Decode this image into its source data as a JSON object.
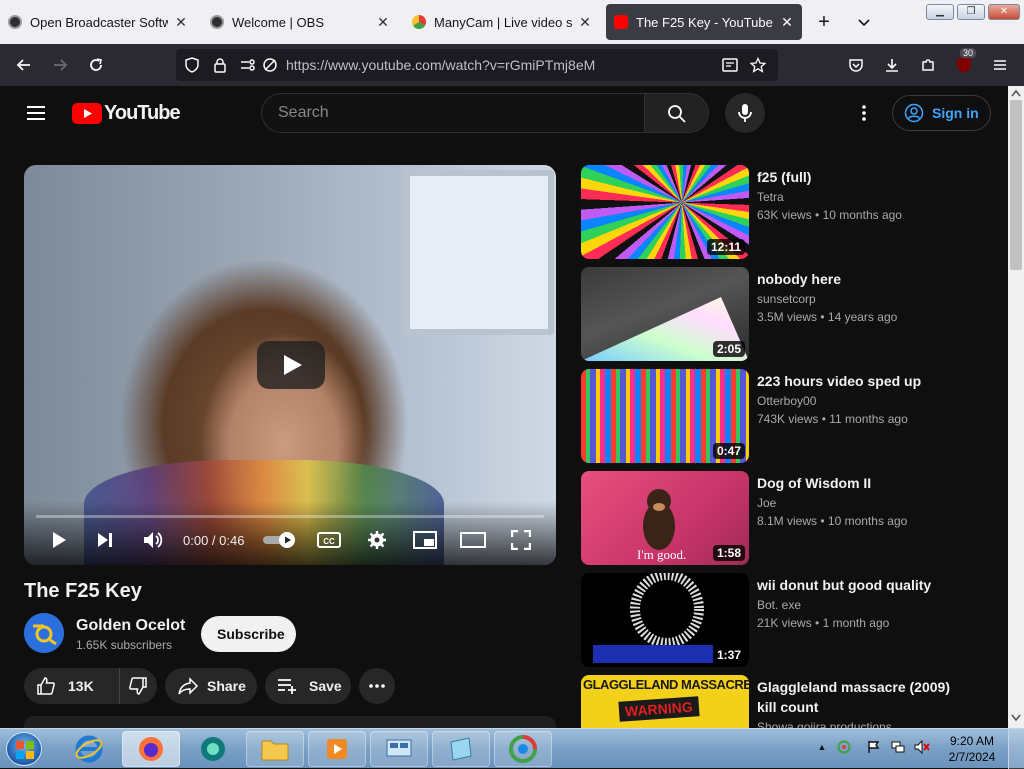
{
  "browser": {
    "tabs": [
      {
        "title": "Open Broadcaster Software",
        "active": false,
        "icon": "obs-icon"
      },
      {
        "title": "Welcome | OBS",
        "active": false,
        "icon": "obs-icon"
      },
      {
        "title": "ManyCam | Live video soft",
        "active": false,
        "icon": "manycam-icon"
      },
      {
        "title": "The F25 Key - YouTube",
        "active": true,
        "icon": "youtube-icon"
      }
    ],
    "url": "https://www.youtube.com/watch?v=rGmiPTmj8eM",
    "extension_badge": "30"
  },
  "youtube": {
    "logo_text": "YouTube",
    "search_placeholder": "Search",
    "sign_in": "Sign in"
  },
  "video": {
    "title": "The F25 Key",
    "time": "0:00 / 0:46",
    "progress": 0,
    "channel": {
      "name": "Golden Ocelot",
      "subscribers": "1.65K subscribers"
    },
    "subscribe_label": "Subscribe",
    "like_count": "13K",
    "share_label": "Share",
    "save_label": "Save"
  },
  "recommendations": [
    {
      "title": "f25 (full)",
      "channel": "Tetra",
      "views": "63K views",
      "age": "10 months ago",
      "duration": "12:11"
    },
    {
      "title": "nobody here",
      "channel": "sunsetcorp",
      "views": "3.5M views",
      "age": "14 years ago",
      "duration": "2:05"
    },
    {
      "title": "223 hours video sped up",
      "channel": "Otterboy00",
      "views": "743K views",
      "age": "11 months ago",
      "duration": "0:47"
    },
    {
      "title": "Dog of Wisdom II",
      "channel": "Joe",
      "views": "8.1M views",
      "age": "10 months ago",
      "duration": "1:58",
      "thumb_caption": "I'm good."
    },
    {
      "title": "wii donut but good quality",
      "channel": "Bot. exe",
      "views": "21K views",
      "age": "1 month ago",
      "duration": "1:37"
    },
    {
      "title": "Glaggleland massacre (2009) kill count",
      "channel": "Showa gojira productions",
      "thumb_caption": "GLAGGLELAND MASSACRE",
      "thumb_warning": "WARNING"
    }
  ],
  "taskbar": {
    "time": "9:20 AM",
    "date": "2/7/2024"
  }
}
